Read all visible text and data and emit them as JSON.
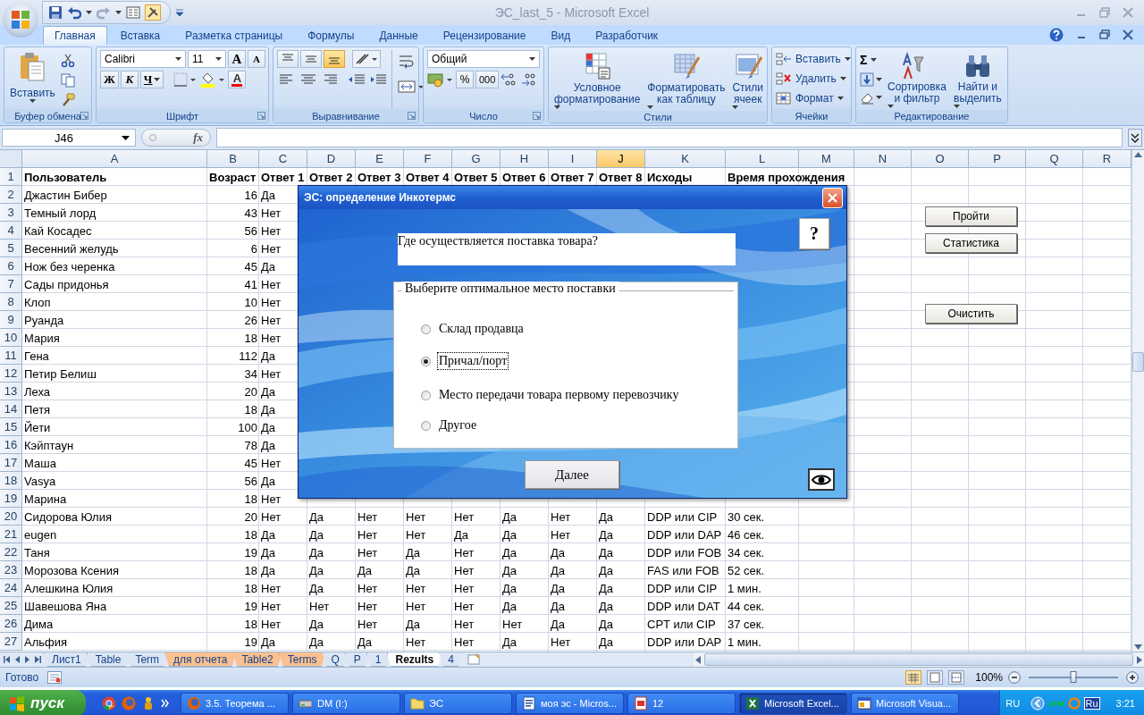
{
  "window": {
    "title": "ЭС_last_5 - Microsoft Excel"
  },
  "ribbon_tabs": [
    {
      "label": "Главная",
      "selected": true
    },
    {
      "label": "Вставка",
      "selected": false
    },
    {
      "label": "Разметка страницы",
      "selected": false
    },
    {
      "label": "Формулы",
      "selected": false
    },
    {
      "label": "Данные",
      "selected": false
    },
    {
      "label": "Рецензирование",
      "selected": false
    },
    {
      "label": "Вид",
      "selected": false
    },
    {
      "label": "Разработчик",
      "selected": false
    }
  ],
  "ribbon": {
    "clipboard": {
      "paste": "Вставить",
      "group": "Буфер обмена"
    },
    "font": {
      "name": "Calibri",
      "size": "11",
      "grow": "A",
      "shrink": "A",
      "bold": "Ж",
      "italic": "К",
      "underline": "Ч",
      "color_letter": "A",
      "group": "Шрифт"
    },
    "alignment": {
      "vertical": [
        {
          "selected": false
        },
        {
          "selected": false
        },
        {
          "selected": true
        }
      ],
      "group": "Выравнивание"
    },
    "number": {
      "format": "Общий",
      "percent": "%",
      "thousands": "000",
      "group": "Число"
    },
    "styles": {
      "buttons": [
        "Условное форматирование",
        "Форматировать как таблицу",
        "Стили ячеек"
      ],
      "group": "Стили"
    },
    "cells": {
      "buttons": [
        "Вставить",
        "Удалить",
        "Формат"
      ],
      "group": "Ячейки"
    },
    "editing": {
      "sum": "Σ",
      "buttons": [
        "Сортировка и фильтр",
        "Найти и выделить"
      ],
      "group": "Редактирование"
    }
  },
  "formula_bar": {
    "name_box": "J46",
    "fx": "fx"
  },
  "columns": [
    {
      "label": "A",
      "selected": false
    },
    {
      "label": "B",
      "selected": false
    },
    {
      "label": "C",
      "selected": false
    },
    {
      "label": "D",
      "selected": false
    },
    {
      "label": "E",
      "selected": false
    },
    {
      "label": "F",
      "selected": false
    },
    {
      "label": "G",
      "selected": false
    },
    {
      "label": "H",
      "selected": false
    },
    {
      "label": "I",
      "selected": false
    },
    {
      "label": "J",
      "selected": true
    },
    {
      "label": "K",
      "selected": false
    },
    {
      "label": "L",
      "selected": false
    },
    {
      "label": "M",
      "selected": false
    },
    {
      "label": "N",
      "selected": false
    },
    {
      "label": "O",
      "selected": false
    },
    {
      "label": "P",
      "selected": false
    },
    {
      "label": "Q",
      "selected": false
    },
    {
      "label": "R",
      "selected": false
    }
  ],
  "rows": [
    {
      "number": "1",
      "cells": [
        "Пользователь",
        "Возраст",
        "Ответ 1",
        "Ответ 2",
        "Ответ 3",
        "Ответ 4",
        "Ответ 5",
        "Ответ 6",
        "Ответ 7",
        "Ответ 8",
        "Исходы",
        "Время прохождения"
      ]
    },
    {
      "number": "2",
      "cells": [
        "Джастин Бибер",
        "16",
        "Да"
      ]
    },
    {
      "number": "3",
      "cells": [
        "Темный лорд",
        "43",
        "Нет"
      ]
    },
    {
      "number": "4",
      "cells": [
        "Кай Косадес",
        "56",
        "Нет"
      ]
    },
    {
      "number": "5",
      "cells": [
        "Весенний желудь",
        "6",
        "Нет"
      ]
    },
    {
      "number": "6",
      "cells": [
        "Нож без черенка",
        "45",
        "Да"
      ]
    },
    {
      "number": "7",
      "cells": [
        "Сады придонья",
        "41",
        "Нет"
      ]
    },
    {
      "number": "8",
      "cells": [
        "Клоп",
        "10",
        "Нет"
      ]
    },
    {
      "number": "9",
      "cells": [
        "Руанда",
        "26",
        "Нет"
      ]
    },
    {
      "number": "10",
      "cells": [
        "Мария",
        "18",
        "Нет"
      ]
    },
    {
      "number": "11",
      "cells": [
        "Гена",
        "112",
        "Да"
      ]
    },
    {
      "number": "12",
      "cells": [
        "Петир Белиш",
        "34",
        "Нет"
      ]
    },
    {
      "number": "13",
      "cells": [
        "Леха",
        "20",
        "Да"
      ]
    },
    {
      "number": "14",
      "cells": [
        "Петя",
        "18",
        "Да"
      ]
    },
    {
      "number": "15",
      "cells": [
        "Йети",
        "100",
        "Да"
      ]
    },
    {
      "number": "16",
      "cells": [
        "Кэйптаун",
        "78",
        "Да"
      ]
    },
    {
      "number": "17",
      "cells": [
        "Маша",
        "45",
        "Нет"
      ]
    },
    {
      "number": "18",
      "cells": [
        "Vasya",
        "56",
        "Да"
      ]
    },
    {
      "number": "19",
      "cells": [
        "Марина",
        "18",
        "Нет"
      ]
    },
    {
      "number": "20",
      "cells": [
        "Сидорова Юлия",
        "20",
        "Нет",
        "Да",
        "Нет",
        "Нет",
        "Нет",
        "Да",
        "Нет",
        "Да",
        "DDP или CIP",
        "30 сек."
      ]
    },
    {
      "number": "21",
      "cells": [
        "eugen",
        "18",
        "Да",
        "Да",
        "Нет",
        "Нет",
        "Да",
        "Да",
        "Нет",
        "Да",
        "DDP или DAP",
        "46 сек."
      ]
    },
    {
      "number": "22",
      "cells": [
        "Таня",
        "19",
        "Да",
        "Да",
        "Нет",
        "Да",
        "Нет",
        "Да",
        "Да",
        "Да",
        "DDP или FOB",
        "34 сек."
      ]
    },
    {
      "number": "23",
      "cells": [
        "Морозова Ксения",
        "18",
        "Да",
        "Да",
        "Да",
        "Да",
        "Нет",
        "Да",
        "Да",
        "Да",
        "FAS или FOB",
        "52 сек."
      ]
    },
    {
      "number": "24",
      "cells": [
        "Алешкина Юлия",
        "18",
        "Нет",
        "Да",
        "Нет",
        "Нет",
        "Нет",
        "Да",
        "Да",
        "Да",
        "DDP или CIP",
        "1 мин."
      ]
    },
    {
      "number": "25",
      "cells": [
        "Шавешова Яна",
        "19",
        "Нет",
        "Нет",
        "Нет",
        "Нет",
        "Нет",
        "Да",
        "Да",
        "Да",
        "DDP или DAT",
        "44 сек."
      ]
    },
    {
      "number": "26",
      "cells": [
        "Дима",
        "18",
        "Нет",
        "Да",
        "Нет",
        "Да",
        "Нет",
        "Нет",
        "Да",
        "Да",
        "CPT или CIP",
        "37 сек."
      ]
    },
    {
      "number": "27",
      "cells": [
        "Альфия",
        "19",
        "Да",
        "Да",
        "Да",
        "Нет",
        "Нет",
        "Да",
        "Нет",
        "Да",
        "DDP или DAP",
        "1 мин."
      ]
    }
  ],
  "sheet_buttons": [
    "Пройти",
    "Статистика",
    "Очистить"
  ],
  "dialog": {
    "title": "ЭС: определение Инкотермс",
    "help": "?",
    "question": "Где осуществляется поставка товара?",
    "group_label": "Выберите оптимальное место поставки",
    "options": [
      {
        "label": "Склад продавца",
        "selected": false
      },
      {
        "label": "Причал/порт",
        "selected": true
      },
      {
        "label": "Место передачи товара первому перевозчику",
        "selected": false
      },
      {
        "label": "Другое",
        "selected": false
      }
    ],
    "next": "Далее"
  },
  "sheet_tabs": [
    {
      "label": "Лист1",
      "selected": false
    },
    {
      "label": "Table",
      "selected": false
    },
    {
      "label": "Term",
      "selected": false
    },
    {
      "label": "для отчета",
      "selected": false,
      "color": "#fac090"
    },
    {
      "label": "Table2",
      "selected": false,
      "color": "#fac090"
    },
    {
      "label": "Terms",
      "selected": false,
      "color": "#fac090"
    },
    {
      "label": "Q",
      "selected": false
    },
    {
      "label": "P",
      "selected": false
    },
    {
      "label": "1",
      "selected": false
    },
    {
      "label": "Rezults",
      "selected": true
    },
    {
      "label": "4",
      "selected": false
    }
  ],
  "status_bar": {
    "text": "Готово",
    "zoom": "100%",
    "zoom_slider": {
      "level": 0.5
    }
  },
  "taskbar": {
    "start": "пуск",
    "tasks": [
      {
        "label": "3.5. Теорема ...",
        "kind": "browser",
        "selected": false
      },
      {
        "label": "DM (I:)",
        "kind": "drive",
        "selected": false
      },
      {
        "label": "ЭС",
        "kind": "folder",
        "selected": false
      },
      {
        "label": "моя эс - Micros...",
        "kind": "word",
        "selected": false
      },
      {
        "label": "12",
        "kind": "pdf",
        "selected": false
      },
      {
        "label": "Microsoft Excel...",
        "kind": "excel",
        "selected": true
      },
      {
        "label": "Microsoft Visua...",
        "kind": "vb",
        "selected": false
      }
    ],
    "language": "RU",
    "tray_labels": [
      "UTM",
      "Ru"
    ],
    "clock": "3:21"
  }
}
